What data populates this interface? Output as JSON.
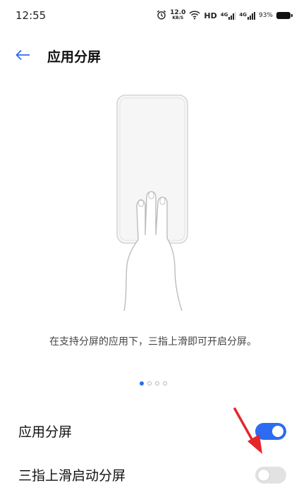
{
  "status_bar": {
    "time": "12:55",
    "alarm_icon": "alarm-clock-icon",
    "speed_value": "12.0",
    "speed_unit": "KB/S",
    "wifi_icon": "wifi-icon",
    "hd_label": "HD",
    "signal1_label": "4G",
    "signal2_label": "4G",
    "battery_percent": "93%",
    "battery_icon": "battery-icon"
  },
  "header": {
    "back_icon": "back-arrow-icon",
    "title": "应用分屏"
  },
  "illustration": {
    "icon": "three-finger-swipe-illustration"
  },
  "description": "在支持分屏的应用下，三指上滑即可开启分屏。",
  "pager": {
    "total": 4,
    "active_index": 0
  },
  "settings": [
    {
      "label": "应用分屏",
      "enabled": true
    },
    {
      "label": "三指上滑启动分屏",
      "enabled": false
    }
  ],
  "colors": {
    "accent": "#2c6bf2",
    "annotation_arrow": "#e5262a"
  }
}
